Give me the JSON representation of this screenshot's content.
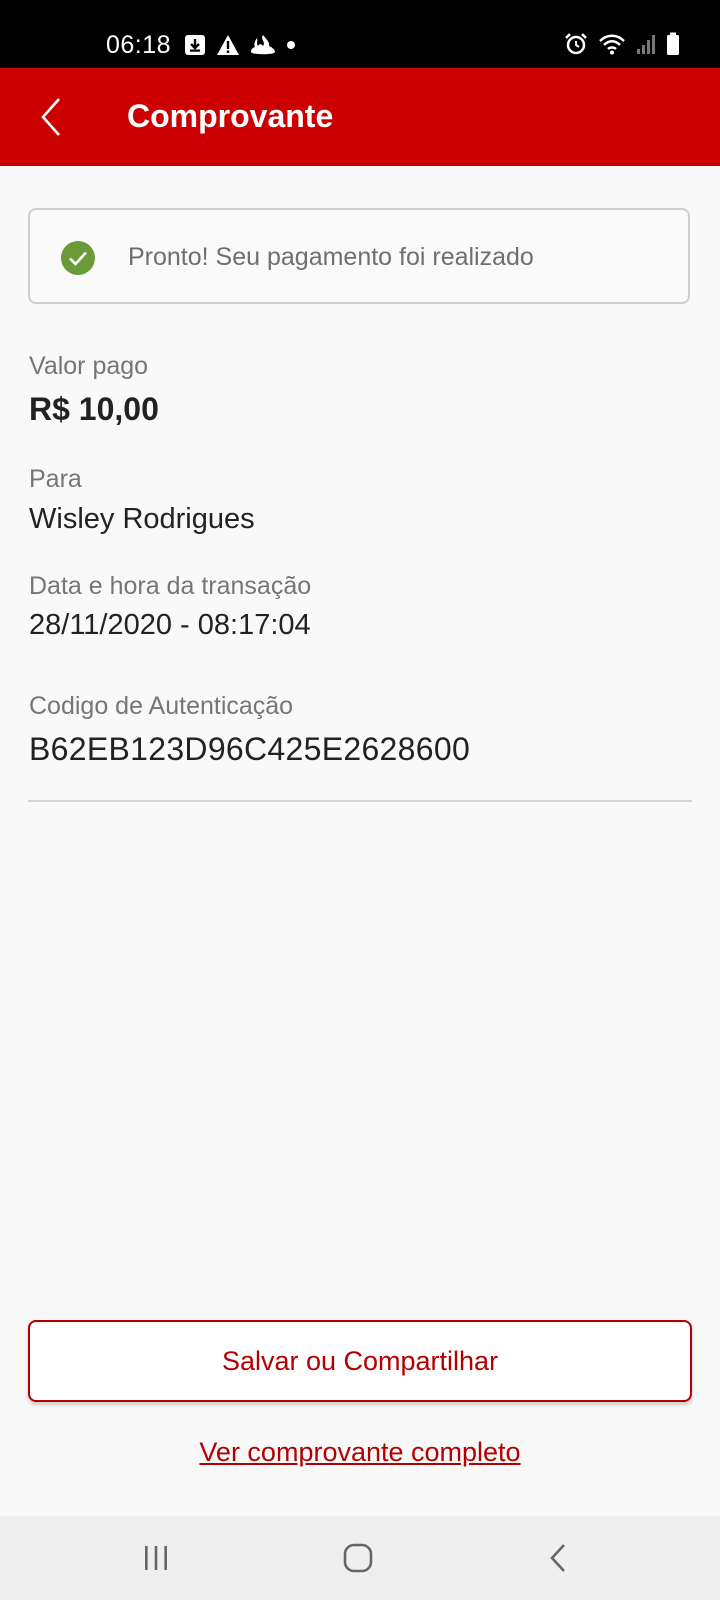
{
  "status_bar": {
    "time": "06:18",
    "left_icons": [
      "download-icon",
      "warning-icon",
      "santander-flame-icon",
      "notification-dot-icon"
    ],
    "right_icons": [
      "alarm-icon",
      "wifi-icon",
      "signal-icon",
      "battery-icon"
    ]
  },
  "header": {
    "title": "Comprovante",
    "back_icon": "chevron-left-icon",
    "background_color": "#cc0000"
  },
  "banner": {
    "icon": "check-circle-icon",
    "icon_color": "#6a9a3a",
    "message": "Pronto! Seu pagamento foi realizado"
  },
  "details": {
    "amount_label": "Valor pago",
    "amount_value": "R$ 10,00",
    "recipient_label": "Para",
    "recipient_value": "Wisley Rodrigues",
    "datetime_label": "Data e hora da transação",
    "datetime_value": "28/11/2020 - 08:17:04",
    "auth_label": "Codigo de Autenticação",
    "auth_value": "B62EB123D96C425E2628600"
  },
  "actions": {
    "share_label": "Salvar ou Compartilhar",
    "full_receipt_label": "Ver comprovante completo",
    "accent_color": "#b30000"
  },
  "nav_bar": {
    "icons": [
      "recent-apps-icon",
      "home-icon",
      "back-icon"
    ]
  }
}
